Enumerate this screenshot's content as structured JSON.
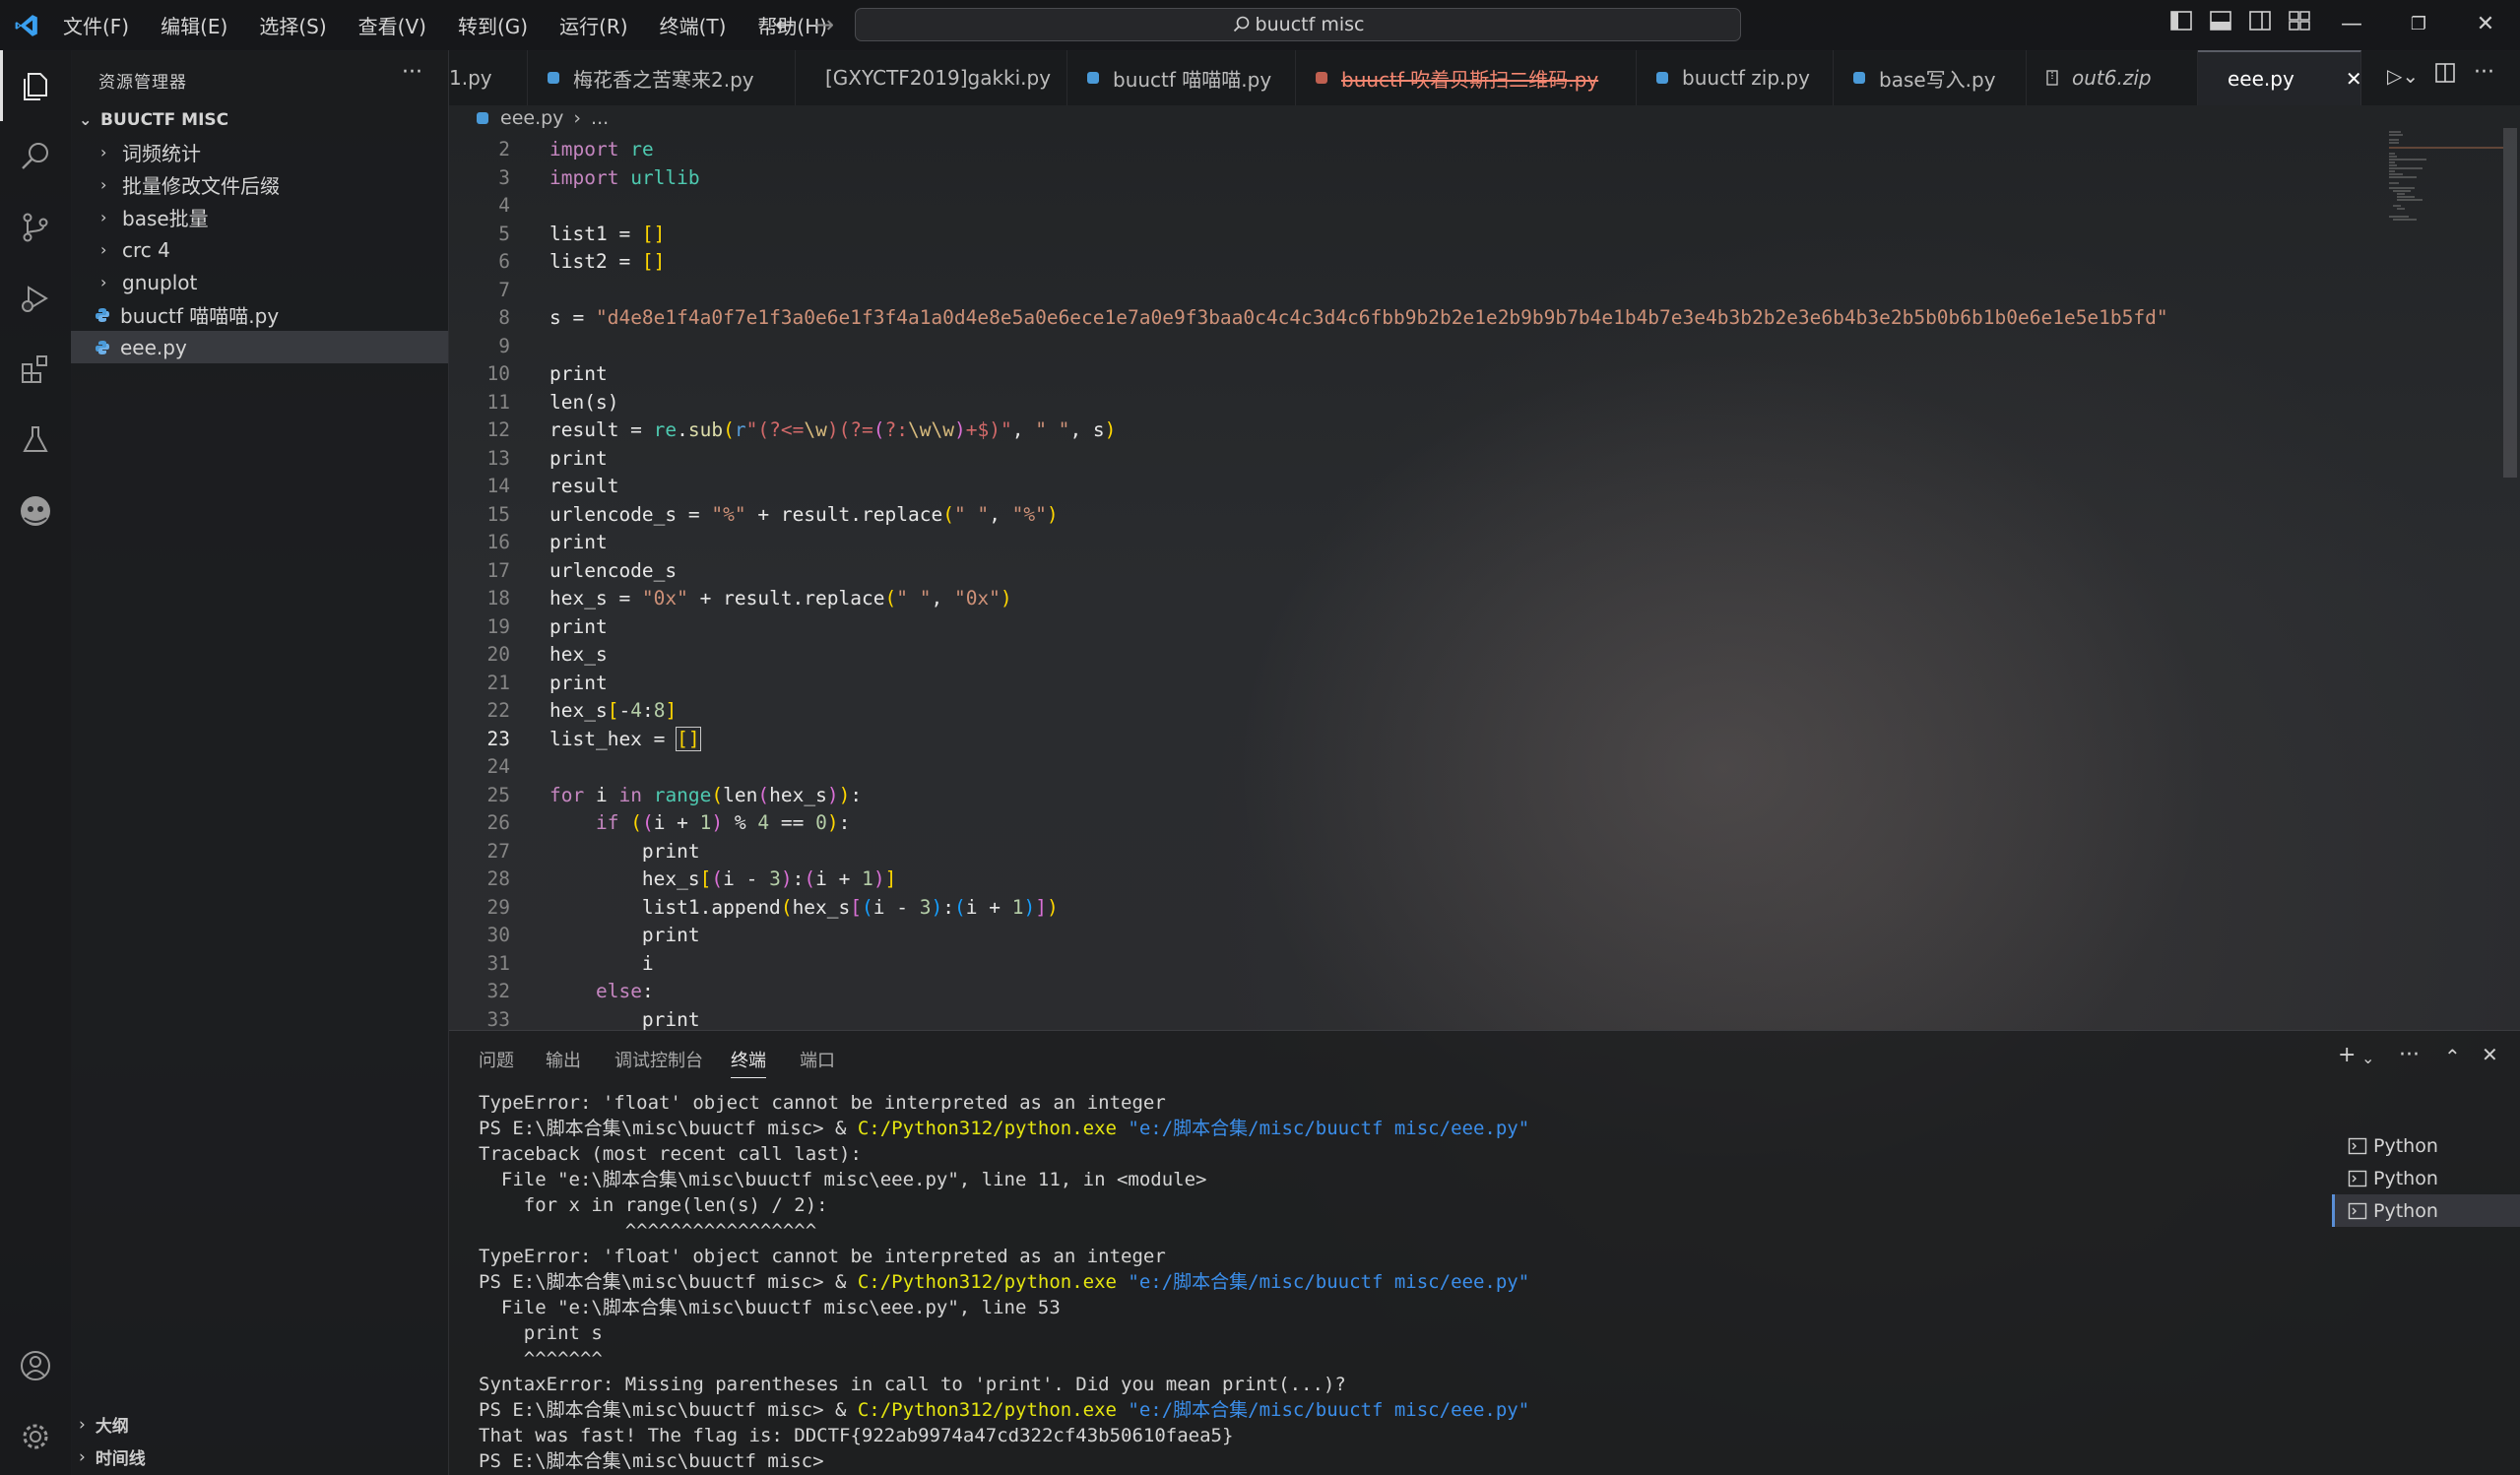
{
  "window": {
    "search_text": "buuctf misc",
    "menu": [
      "文件(F)",
      "编辑(E)",
      "选择(S)",
      "查看(V)",
      "转到(G)",
      "运行(R)",
      "终端(T)",
      "帮助(H)"
    ]
  },
  "sidebar": {
    "title": "资源管理器",
    "more": "···",
    "folder": "BUUCTF MISC",
    "items": [
      {
        "label": "词频统计",
        "type": "folder"
      },
      {
        "label": "批量修改文件后缀",
        "type": "folder"
      },
      {
        "label": "base批量",
        "type": "folder"
      },
      {
        "label": "crc 4",
        "type": "folder"
      },
      {
        "label": "gnuplot",
        "type": "folder"
      },
      {
        "label": "buuctf 喵喵喵.py",
        "type": "file"
      },
      {
        "label": "eee.py",
        "type": "file",
        "selected": true
      }
    ],
    "outline": "大纲",
    "timeline": "时间线"
  },
  "tabs": [
    {
      "label": "1.py"
    },
    {
      "label": "梅花香之苦寒来2.py"
    },
    {
      "label": "[GXYCTF2019]gakki.py"
    },
    {
      "label": "buuctf 喵喵喵.py"
    },
    {
      "label": "buuctf 吹着贝斯扫二维码.py",
      "deleted": true
    },
    {
      "label": "buuctf zip.py"
    },
    {
      "label": "base写入.py"
    },
    {
      "label": "out6.zip",
      "italic": true
    },
    {
      "label": "eee.py",
      "active": true
    }
  ],
  "breadcrumb": {
    "file": "eee.py",
    "sep": "›",
    "rest": "..."
  },
  "editor": {
    "current_line": 23,
    "line_numbers": [
      "2",
      "3",
      "4",
      "5",
      "6",
      "7",
      "8",
      "9",
      "10",
      "11",
      "12",
      "13",
      "14",
      "15",
      "16",
      "17",
      "18",
      "19",
      "20",
      "21",
      "22",
      "23",
      "24",
      "25",
      "26",
      "27",
      "28",
      "29",
      "30",
      "31",
      "32",
      "33"
    ],
    "hex_string": "\"d4e8e1f4a0f7e1f3a0e6e1f3f4a1a0d4e8e5a0e6ece1e7a0e9f3baa0c4c4c3d4c6fbb9b2b2e1e2b9b9b7b4e1b4b7e3e4b3b2b2e3e6b4b3e2b5b0b6b1b0e6e1e5e1b5fd\""
  },
  "panel": {
    "tabs": [
      "问题",
      "输出",
      "调试控制台",
      "终端",
      "端口"
    ],
    "active_tab": "终端",
    "terminal_lines": [
      {
        "t": "TypeError: 'float' object cannot be interpreted as an integer"
      },
      {
        "prompt": "PS E:\\脚本合集\\misc\\buuctf misc> & ",
        "exe": "C:/Python312/python.exe",
        "arg": " \"e:/脚本合集/misc/buuctf misc/eee.py\""
      },
      {
        "t": "Traceback (most recent call last):"
      },
      {
        "t": "  File \"e:\\脚本合集\\misc\\buuctf misc\\eee.py\", line 11, in <module>"
      },
      {
        "t": "    for x in range(len(s) / 2):"
      },
      {
        "t": "             ^^^^^^^^^^^^^^^^^"
      },
      {
        "t": "TypeError: 'float' object cannot be interpreted as an integer"
      },
      {
        "prompt": "PS E:\\脚本合集\\misc\\buuctf misc> & ",
        "exe": "C:/Python312/python.exe",
        "arg": " \"e:/脚本合集/misc/buuctf misc/eee.py\""
      },
      {
        "t": "  File \"e:\\脚本合集\\misc\\buuctf misc\\eee.py\", line 53"
      },
      {
        "t": "    print s"
      },
      {
        "t": "    ^^^^^^^"
      },
      {
        "t": "SyntaxError: Missing parentheses in call to 'print'. Did you mean print(...)?"
      },
      {
        "prompt": "PS E:\\脚本合集\\misc\\buuctf misc> & ",
        "exe": "C:/Python312/python.exe",
        "arg": " \"e:/脚本合集/misc/buuctf misc/eee.py\""
      },
      {
        "t": "That was fast! The flag is: DDCTF{922ab9974a47cd322cf43b50610faea5}"
      },
      {
        "t": "PS E:\\脚本合集\\misc\\buuctf misc> "
      }
    ],
    "terminals": [
      "Python",
      "Python",
      "Python"
    ],
    "active_terminal": 2
  },
  "colors": {
    "accent": "#007acc",
    "string": "#ce9178",
    "keyword": "#c586c0",
    "function": "#dcdcaa"
  }
}
